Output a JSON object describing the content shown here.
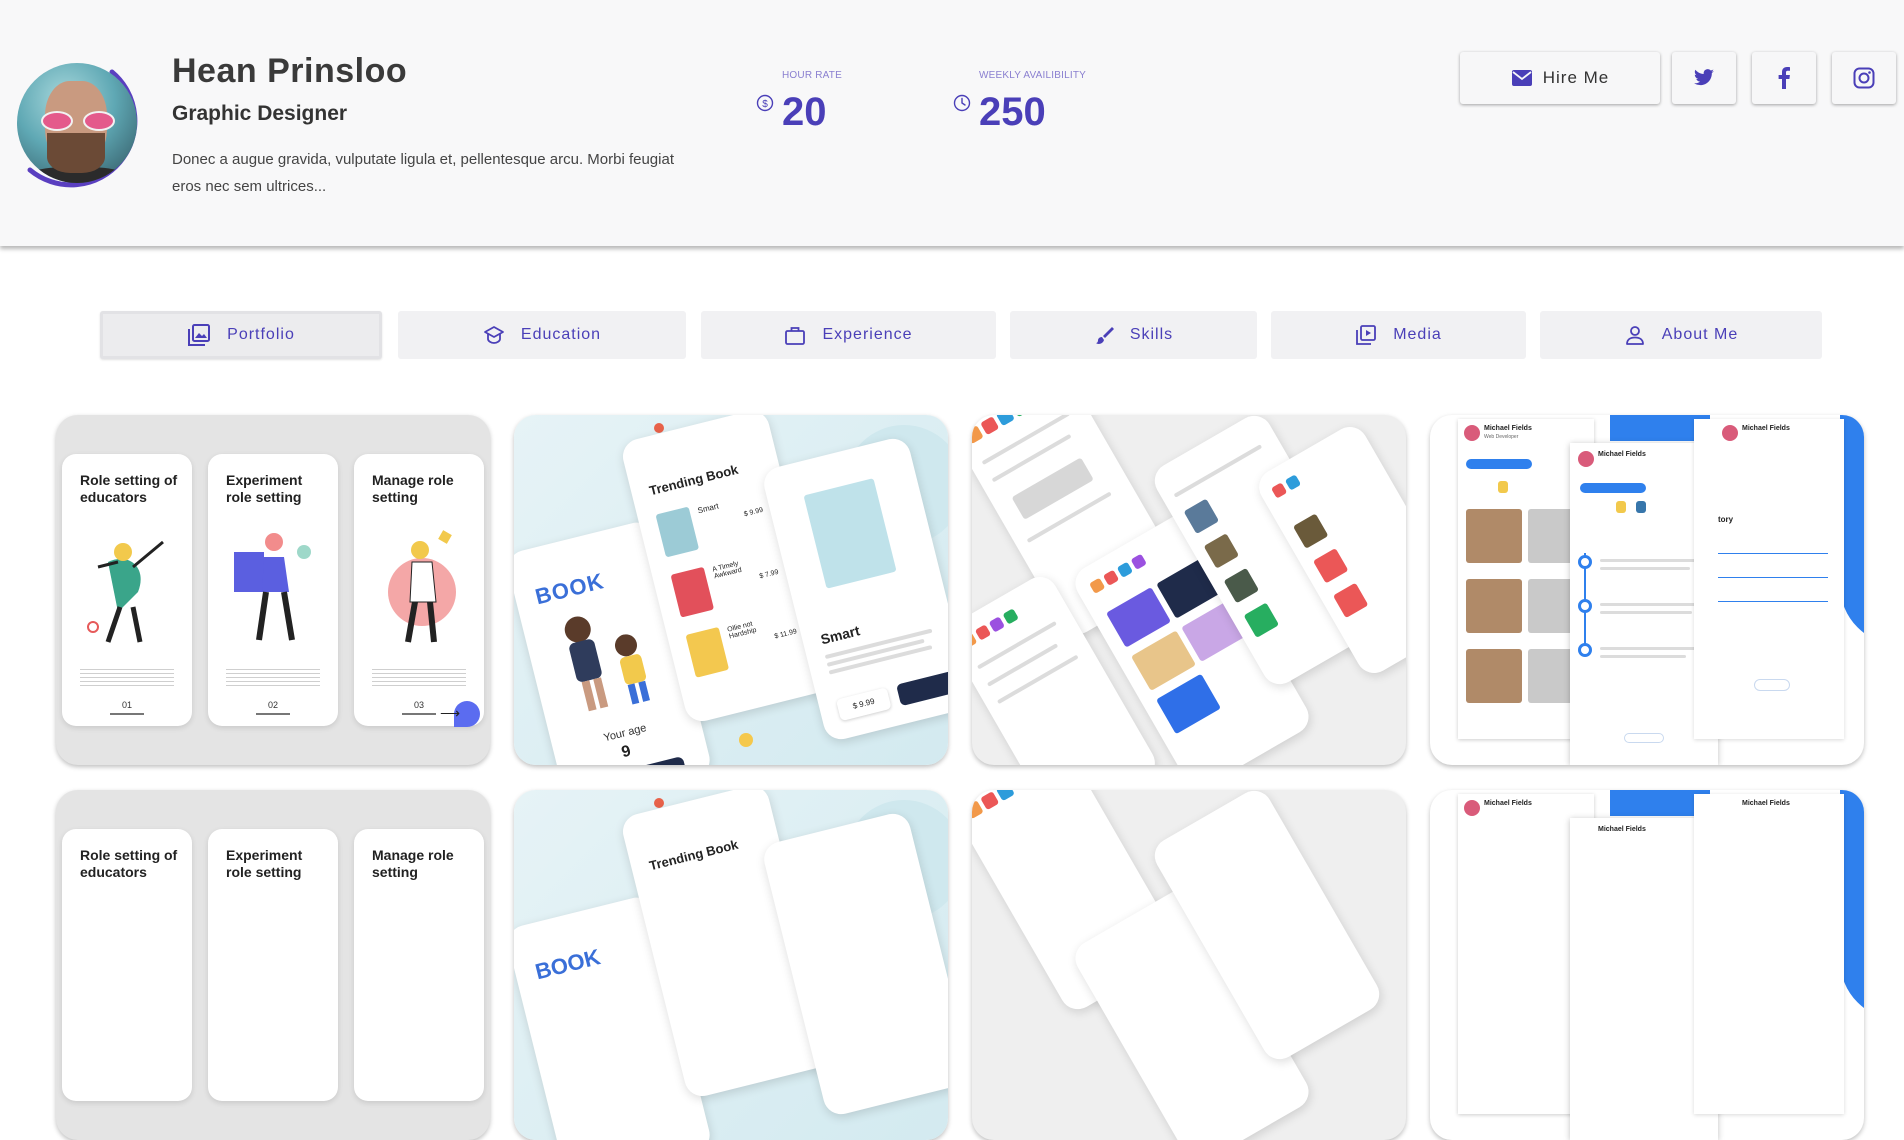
{
  "profile": {
    "name": "Hean Prinsloo",
    "role": "Graphic Designer",
    "bio": "Donec a augue gravida, vulputate ligula et, pellentesque arcu. Morbi feugiat eros nec sem ultrices..."
  },
  "stats": {
    "hour_rate": {
      "label": "HOUR RATE",
      "value": "20",
      "icon": "dollar-circle-icon"
    },
    "weekly": {
      "label": "WEEKLY AVAILIBILITY",
      "value": "250",
      "icon": "clock-icon"
    }
  },
  "actions": {
    "hire_label": "Hire Me",
    "hire_icon": "mail-icon",
    "social": [
      "twitter-icon",
      "facebook-icon",
      "instagram-icon"
    ]
  },
  "tabs": [
    {
      "label": "Portfolio",
      "icon": "image-icon",
      "active": true
    },
    {
      "label": "Education",
      "icon": "graduation-cap-icon"
    },
    {
      "label": "Experience",
      "icon": "briefcase-icon"
    },
    {
      "label": "Skills",
      "icon": "brush-icon"
    },
    {
      "label": "Media",
      "icon": "video-library-icon"
    },
    {
      "label": "About Me",
      "icon": "person-icon"
    }
  ],
  "portfolio": {
    "onboarding": {
      "screens": [
        {
          "title": "Role setting of educators",
          "num": "01"
        },
        {
          "title": "Experiment role setting",
          "num": "02"
        },
        {
          "title": "Manage role setting",
          "num": "03"
        }
      ]
    },
    "book_app": {
      "heading": "Trending Book",
      "logo": "BOOK",
      "age_label": "Your age",
      "age_value": "9",
      "book_title": "Smart",
      "books": [
        {
          "title": "Smart",
          "price": "$ 9.99"
        },
        {
          "title": "A Timely Awkward",
          "price": "$ 7.99"
        },
        {
          "title": "Ollie not Hardship",
          "price": "$ 11.99"
        }
      ],
      "detail_price": "$ 9.99"
    },
    "profile_app": {
      "user_name": "Michael Fields",
      "user_role": "Web Developer",
      "section": "tory"
    }
  },
  "colors": {
    "accent": "#4a3fb8",
    "header_bg": "#f8f8f9",
    "tab_bg": "#f1f1f3",
    "blue": "#2f80ed"
  }
}
